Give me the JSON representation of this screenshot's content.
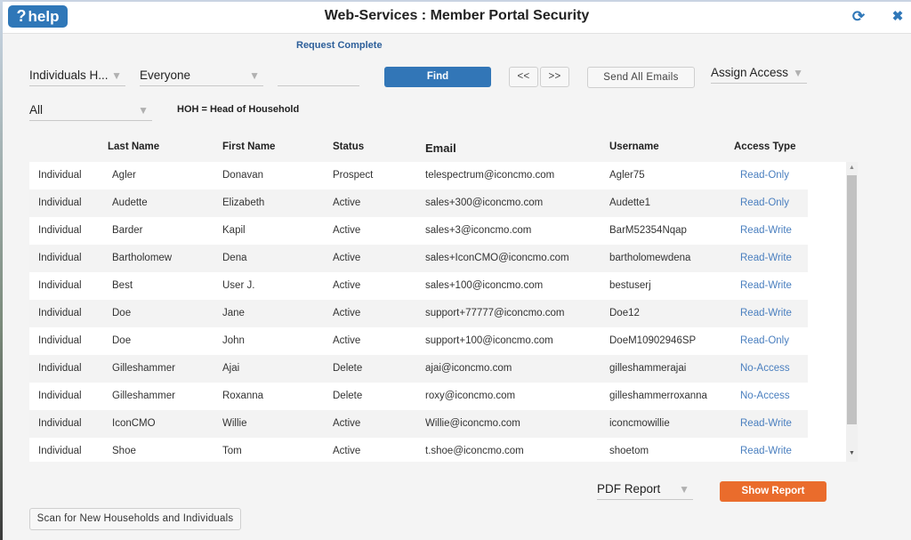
{
  "header": {
    "help_label": "help",
    "help_icon": "?",
    "title": "Web-Services : Member Portal Security",
    "refresh_icon": "⟳",
    "close_icon": "✖"
  },
  "status_message": "Request Complete",
  "filters": {
    "type_select": "Individuals H...",
    "group_select": "Everyone",
    "search_value": "",
    "status_select": "All",
    "assign_access_select": "Assign Access",
    "hoh_note": "HOH = Head of Household"
  },
  "toolbar": {
    "find_label": "Find",
    "prev_label": "<<",
    "next_label": ">>",
    "send_all_emails_label": "Send All Emails"
  },
  "table": {
    "columns": [
      "",
      "Last Name",
      "First Name",
      "Status",
      "Email",
      "Username",
      "Access Type"
    ],
    "rows": [
      {
        "type": "Individual",
        "last": "Agler",
        "first": "Donavan",
        "status": "Prospect",
        "email": "telespectrum@iconcmo.com",
        "username": "Agler75",
        "access": "Read-Only"
      },
      {
        "type": "Individual",
        "last": "Audette",
        "first": "Elizabeth",
        "status": "Active",
        "email": "sales+300@iconcmo.com",
        "username": "Audette1",
        "access": "Read-Only"
      },
      {
        "type": "Individual",
        "last": "Barder",
        "first": "Kapil",
        "status": "Active",
        "email": "sales+3@iconcmo.com",
        "username": "BarM52354Nqap",
        "access": "Read-Write"
      },
      {
        "type": "Individual",
        "last": "Bartholomew",
        "first": "Dena",
        "status": "Active",
        "email": "sales+IconCMO@iconcmo.com",
        "username": "bartholomewdena",
        "access": "Read-Write"
      },
      {
        "type": "Individual",
        "last": "Best",
        "first": "User J.",
        "status": "Active",
        "email": "sales+100@iconcmo.com",
        "username": "bestuserj",
        "access": "Read-Write"
      },
      {
        "type": "Individual",
        "last": "Doe",
        "first": "Jane",
        "status": "Active",
        "email": "support+77777@iconcmo.com",
        "username": "Doe12",
        "access": "Read-Write"
      },
      {
        "type": "Individual",
        "last": "Doe",
        "first": "John",
        "status": "Active",
        "email": "support+100@iconcmo.com",
        "username": "DoeM10902946SP",
        "access": "Read-Only"
      },
      {
        "type": "Individual",
        "last": "Gilleshammer",
        "first": "Ajai",
        "status": "Delete",
        "email": "ajai@iconcmo.com",
        "username": "gilleshammerajai",
        "access": "No-Access"
      },
      {
        "type": "Individual",
        "last": "Gilleshammer",
        "first": "Roxanna",
        "status": "Delete",
        "email": "roxy@iconcmo.com",
        "username": "gilleshammerroxanna",
        "access": "No-Access"
      },
      {
        "type": "Individual",
        "last": "IconCMO",
        "first": "Willie",
        "status": "Active",
        "email": "Willie@iconcmo.com",
        "username": "iconcmowillie",
        "access": "Read-Write"
      },
      {
        "type": "Individual",
        "last": "Shoe",
        "first": "Tom",
        "status": "Active",
        "email": "t.shoe@iconcmo.com",
        "username": "shoetom",
        "access": "Read-Write"
      }
    ]
  },
  "footer": {
    "report_select": "PDF Report",
    "show_report_label": "Show Report",
    "scan_label": "Scan for New Households and Individuals"
  },
  "colors": {
    "primary": "#3276b7",
    "accent_orange": "#ea6c2c",
    "link": "#4a7fbf"
  }
}
